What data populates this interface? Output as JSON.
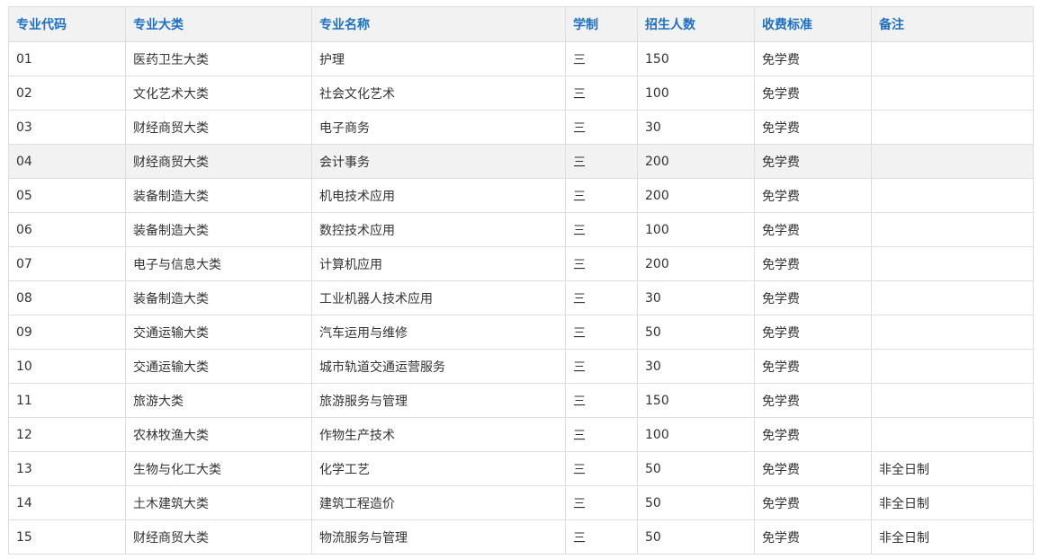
{
  "table": {
    "headers": [
      "专业代码",
      "专业大类",
      "专业名称",
      "学制",
      "招生人数",
      "收费标准",
      "备注"
    ],
    "rows": [
      [
        "01",
        "医药卫生大类",
        "护理",
        "三",
        "150",
        "免学费",
        ""
      ],
      [
        "02",
        "文化艺术大类",
        "社会文化艺术",
        "三",
        "100",
        "免学费",
        ""
      ],
      [
        "03",
        "财经商贸大类",
        "电子商务",
        "三",
        "30",
        "免学费",
        ""
      ],
      [
        "04",
        "财经商贸大类",
        "会计事务",
        "三",
        "200",
        "免学费",
        ""
      ],
      [
        "05",
        "装备制造大类",
        "机电技术应用",
        "三",
        "200",
        "免学费",
        ""
      ],
      [
        "06",
        "装备制造大类",
        "数控技术应用",
        "三",
        "100",
        "免学费",
        ""
      ],
      [
        "07",
        "电子与信息大类",
        "计算机应用",
        "三",
        "200",
        "免学费",
        ""
      ],
      [
        "08",
        "装备制造大类",
        "工业机器人技术应用",
        "三",
        "30",
        "免学费",
        ""
      ],
      [
        "09",
        "交通运输大类",
        "汽车运用与维修",
        "三",
        "50",
        "免学费",
        ""
      ],
      [
        "10",
        "交通运输大类",
        "城市轨道交通运营服务",
        "三",
        "30",
        "免学费",
        ""
      ],
      [
        "11",
        "旅游大类",
        "旅游服务与管理",
        "三",
        "150",
        "免学费",
        ""
      ],
      [
        "12",
        "农林牧渔大类",
        "作物生产技术",
        "三",
        "100",
        "免学费",
        ""
      ],
      [
        "13",
        "生物与化工大类",
        "化学工艺",
        "三",
        "50",
        "免学费",
        "非全日制"
      ],
      [
        "14",
        "土木建筑大类",
        "建筑工程造价",
        "三",
        "50",
        "免学费",
        "非全日制"
      ],
      [
        "15",
        "财经商贸大类",
        "物流服务与管理",
        "三",
        "50",
        "免学费",
        "非全日制"
      ]
    ],
    "highlighted_row": 3
  },
  "colors": {
    "header_text": "#1d6fc4",
    "header_bg": "#f2f2f2",
    "border": "#dedede",
    "body_text": "#333333"
  }
}
